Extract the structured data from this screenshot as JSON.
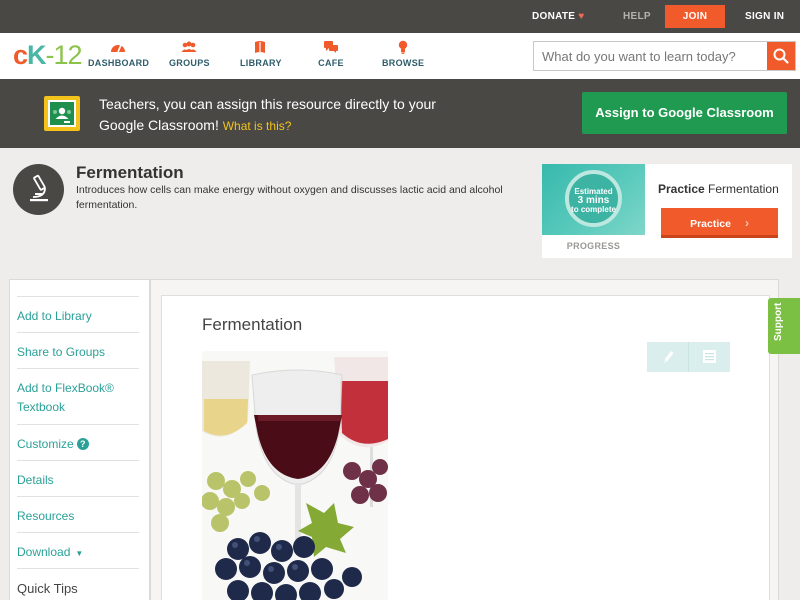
{
  "topbar": {
    "donate": "DONATE",
    "help": "HELP",
    "join": "JOIN",
    "signin": "SIGN IN"
  },
  "logo": {
    "c": "c",
    "k": "K",
    "dash": "-",
    "num": "12"
  },
  "nav": {
    "dashboard": "DASHBOARD",
    "groups": "GROUPS",
    "library": "LIBRARY",
    "cafe": "CAFE",
    "browse": "BROWSE"
  },
  "search": {
    "placeholder": "What do you want to learn today?"
  },
  "banner": {
    "text": "Teachers, you can assign this resource directly to your Google Classroom!",
    "link": "What is this?",
    "button": "Assign to Google Classroom"
  },
  "concept": {
    "title": "Fermentation",
    "description": "Introduces how cells can make energy without oxygen and discusses lactic acid and alcohol fermentation."
  },
  "practice": {
    "estimate_line1": "Estimated",
    "estimate_line2": "3 mins",
    "estimate_line3": "to complete",
    "progress_label": "PROGRESS",
    "title_bold": "Practice",
    "title_rest": "Fermentation",
    "button": "Practice"
  },
  "sidebar": {
    "items": [
      {
        "label": "Add to Library"
      },
      {
        "label": "Share to Groups"
      },
      {
        "label": "Add to FlexBook® Textbook"
      },
      {
        "label": "Customize",
        "badge": "?"
      },
      {
        "label": "Details"
      },
      {
        "label": "Resources"
      },
      {
        "label": "Download",
        "caret": "▼"
      },
      {
        "label": "Quick Tips"
      }
    ]
  },
  "article": {
    "title": "Fermentation"
  },
  "support": {
    "label": "Support"
  },
  "colors": {
    "brand_orange": "#f15a2b",
    "teal": "#2aa198",
    "green": "#1f9a50",
    "dark_bar": "#4a4845"
  },
  "icons": [
    "heart-icon",
    "dashboard-icon",
    "groups-icon",
    "library-icon",
    "cafe-icon",
    "browse-icon",
    "search-icon",
    "google-classroom-icon",
    "microscope-icon",
    "pencil-icon",
    "notes-icon",
    "arrow-right-icon",
    "question-icon",
    "caret-down-icon"
  ]
}
